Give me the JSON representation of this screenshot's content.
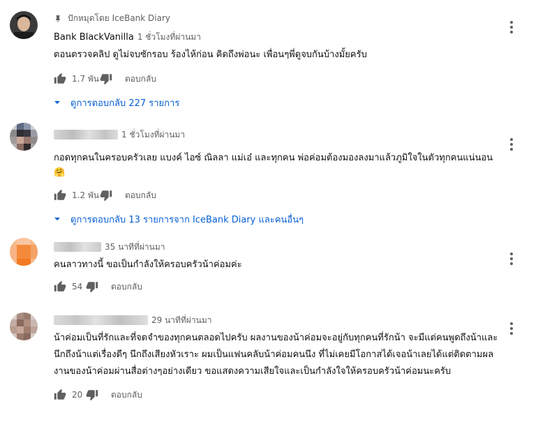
{
  "comments": [
    {
      "pinned_label": "ปักหมุดโดย IceBank Diary",
      "author": "Bank BlackVanilla",
      "time": "1 ชั่วโมงที่ผ่านมา",
      "text": "ตอนตรวจคลิป ดูไม่จบซักรอบ ร้องไห้ก่อน คิดถึงพ่อนะ เพื่อนๆพี่ดูจบกันบ้างมั้ยครับ",
      "likes": "1.7 พัน",
      "reply_label": "ตอบกลับ",
      "replies_link": "ดูการตอบกลับ 227 รายการ"
    },
    {
      "time": "1 ชั่วโมงที่ผ่านมา",
      "text": "กอดทุกคนในครอบครัวเลย  แบงค์ ไอซ์ ณิลลา แม่เอ๋ และทุกคน พ่อค่อมต้องมองลงมาแล้วภูมิใจในตัวทุกคนแน่นอน 🤗",
      "likes": "1.2 พัน",
      "reply_label": "ตอบกลับ",
      "replies_link": "ดูการตอบกลับ 13 รายการจาก IceBank Diary และคนอื่นๆ"
    },
    {
      "time": "35 นาทีที่ผ่านมา",
      "text": "คนลาวทางนี้ ขอเป็นกำลังให้ครอบครัวน้าค่อมค่ะ",
      "likes": "54",
      "reply_label": "ตอบกลับ"
    },
    {
      "time": "29 นาทีที่ผ่านมา",
      "text": "น้าค่อมเป็นที่รักและที่จดจำของทุกคนตลอดไปครับ ผลงานของน้าค่อมจะอยู่กับทุกคนที่รักน้า จะมีแต่คนพูดถึงน้าและนึกถึงน้าแต่เรื่องดีๆ นึกถึงเสียงหัวเราะ  ผมเป็นแฟนคลับน้าค่อมคนนึง ที่ไม่เคยมีโอกาสได้เจอน้าเลยได้แต่ติดตามผลงานของน้าค่อมผ่านสื่อต่างๆอย่างเดียว ขอแสดงความเสียใจและเป็นกำลังใจให้ครอบครัวน้าค่อมนะครับ",
      "likes": "20",
      "reply_label": "ตอบกลับ"
    }
  ],
  "icons": {
    "pin": "pin-icon",
    "like": "thumb-up-icon",
    "dislike": "thumb-down-icon",
    "menu": "more-vert-icon",
    "caret": "caret-down-icon"
  },
  "colors": {
    "link": "#065fd4",
    "secondary_text": "#606060"
  }
}
